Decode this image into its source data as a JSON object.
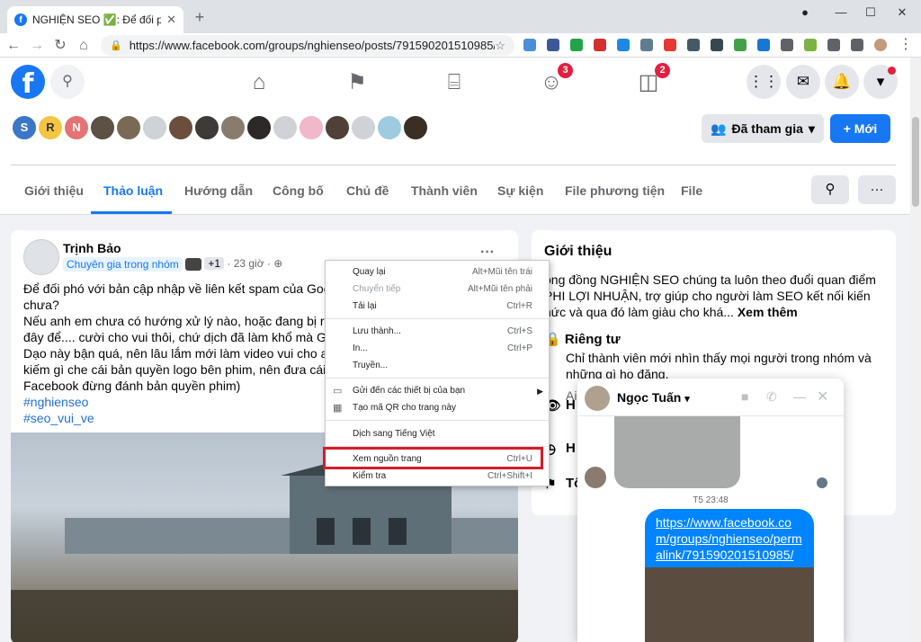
{
  "browser": {
    "tab_title": "NGHIỆN SEO ✅: Để đối phó với",
    "url": "https://www.facebook.com/groups/nghienseo/posts/791590201510985/"
  },
  "fb_topbar": {
    "logo": "f",
    "badge_groups": "3",
    "badge_pages": "2"
  },
  "group": {
    "member_avatars": [
      "S",
      "R",
      "N"
    ],
    "joined_label": "Đã tham gia",
    "new_label": "+ Mới",
    "tabs": [
      "Giới thiệu",
      "Thảo luận",
      "Hướng dẫn",
      "Công bố",
      "Chủ đề",
      "Thành viên",
      "Sự kiện",
      "File phương tiện",
      "File"
    ]
  },
  "post": {
    "author": "Trịnh Bảo",
    "badge": "Chuyên gia trong nhóm",
    "extra": "+1",
    "time": "· 23 giờ ·",
    "lines": [
      "Để đối phó với bản cập nhập về liên kết spam của Goog",
      "chưa?",
      "Nếu anh em chưa có hướng xử lý nào, hoặc đang bị rớt",
      "đây để.... cười cho vui thôi, chứ dịch đã làm khổ mà Goo",
      "Dạo này bận quá, nên lâu lắm mới làm video vui cho anh",
      "kiếm gì che cái bản quyền logo bên phim, nên đưa cái th",
      "Facebook đừng đánh bản quyền phim)"
    ],
    "tags": [
      "#nghienseo",
      "#seo_vui_ve"
    ]
  },
  "about": {
    "title": "Giới thiệu",
    "text": "ộng đồng NGHIỆN SEO chúng ta luôn theo đuổi quan điểm PHI LỢI NHUẬN, trợ giúp cho người làm SEO kết nối kiến hức và qua đó làm giàu cho khá...",
    "see_more": "Xem thêm",
    "privacy_title": "Riêng tư",
    "privacy_desc": "Chỉ thành viên mới nhìn thấy mọi người trong nhóm và những gì họ đăng.",
    "row3": "Ai",
    "row4": "H",
    "row5": "H",
    "row6": "Tổ"
  },
  "context_menu": {
    "back": "Quay lại",
    "back_sc": "Alt+Mũi tên trái",
    "forward": "Chuyển tiếp",
    "forward_sc": "Alt+Mũi tên phải",
    "reload": "Tải lại",
    "reload_sc": "Ctrl+R",
    "save": "Lưu thành...",
    "save_sc": "Ctrl+S",
    "print": "In...",
    "print_sc": "Ctrl+P",
    "cast": "Truyền...",
    "send": "Gửi đến các thiết bị của bạn",
    "qr": "Tạo mã QR cho trang này",
    "translate": "Dịch sang Tiếng Việt",
    "view_source": "Xem nguồn trang",
    "view_source_sc": "Ctrl+U",
    "inspect": "Kiểm tra",
    "inspect_sc": "Ctrl+Shift+I"
  },
  "chat": {
    "name": "Ngọc Tuấn",
    "time": "T5 23:48",
    "link": "https://www.facebook.com/groups/nghienseo/permalink/791590201510985/"
  }
}
